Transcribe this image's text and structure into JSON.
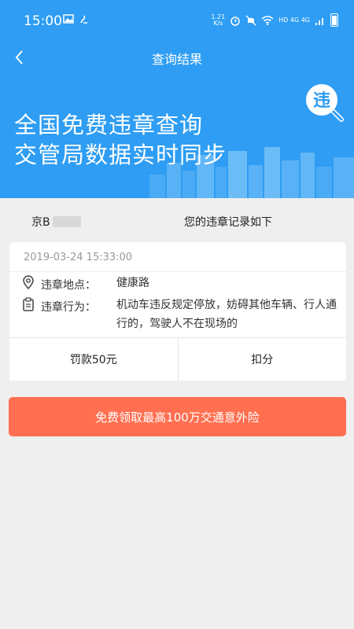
{
  "status_bar": {
    "time": "15:00",
    "net_speed_value": "1.21",
    "net_speed_unit": "K/s",
    "network_label": "HD 4G 4G",
    "icons": [
      "image-icon",
      "notification-icon",
      "alarm-icon",
      "mute-icon",
      "wifi-icon",
      "signal-icon",
      "battery-icon"
    ]
  },
  "nav": {
    "title": "查询结果",
    "back_icon": "back-arrow-icon"
  },
  "banner": {
    "line1": "全国免费违章查询",
    "line2": "交管局数据实时同步",
    "badge_char": "违",
    "colors": {
      "background": "#2e9df3",
      "badge": "#2e9df3"
    }
  },
  "summary": {
    "plate": "京B",
    "hint": "您的违章记录如下"
  },
  "record": {
    "time": "2019-03-24 15:33:00",
    "location_label": "违章地点：",
    "location": "健康路",
    "behavior_label": "违章行为：",
    "behavior": "机动车违反规定停放，妨碍其他车辆、行人通行的，驾驶人不在现场的",
    "fine": "罚款50元",
    "points": "扣分"
  },
  "insurance_button": {
    "label": "免费领取最高100万交通意外险",
    "color": "#ff6f50"
  }
}
